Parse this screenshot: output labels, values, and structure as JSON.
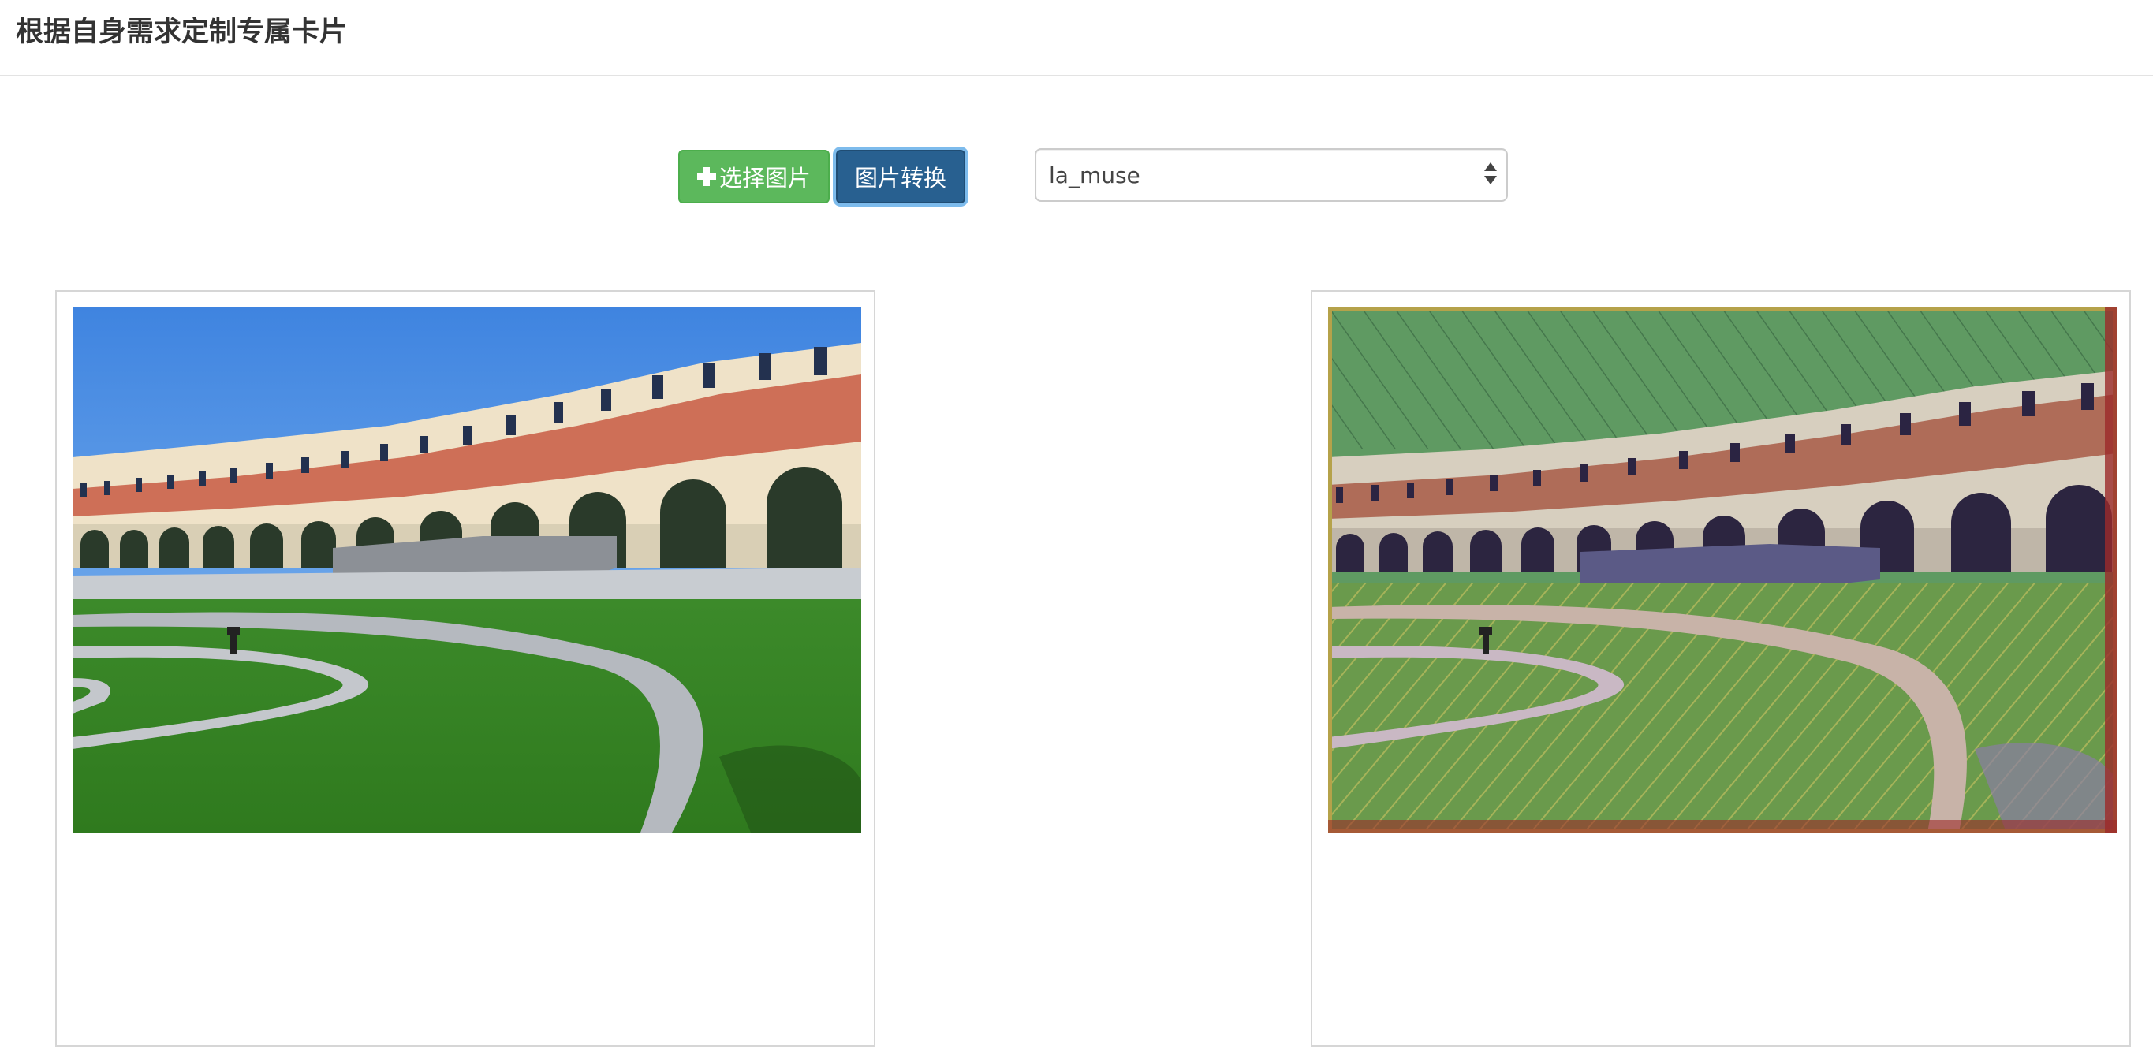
{
  "header": {
    "title": "根据自身需求定制专属卡片"
  },
  "toolbar": {
    "select_image_label": "选择图片",
    "convert_label": "图片转换",
    "select_icon": "plus-icon"
  },
  "style_select": {
    "value": "la_muse",
    "icon": "select-arrows-icon"
  },
  "colors": {
    "success": "#5cb85c",
    "primary": "#286090",
    "focus_ring": "#66afe9",
    "panel_border": "#d6d6d6"
  }
}
